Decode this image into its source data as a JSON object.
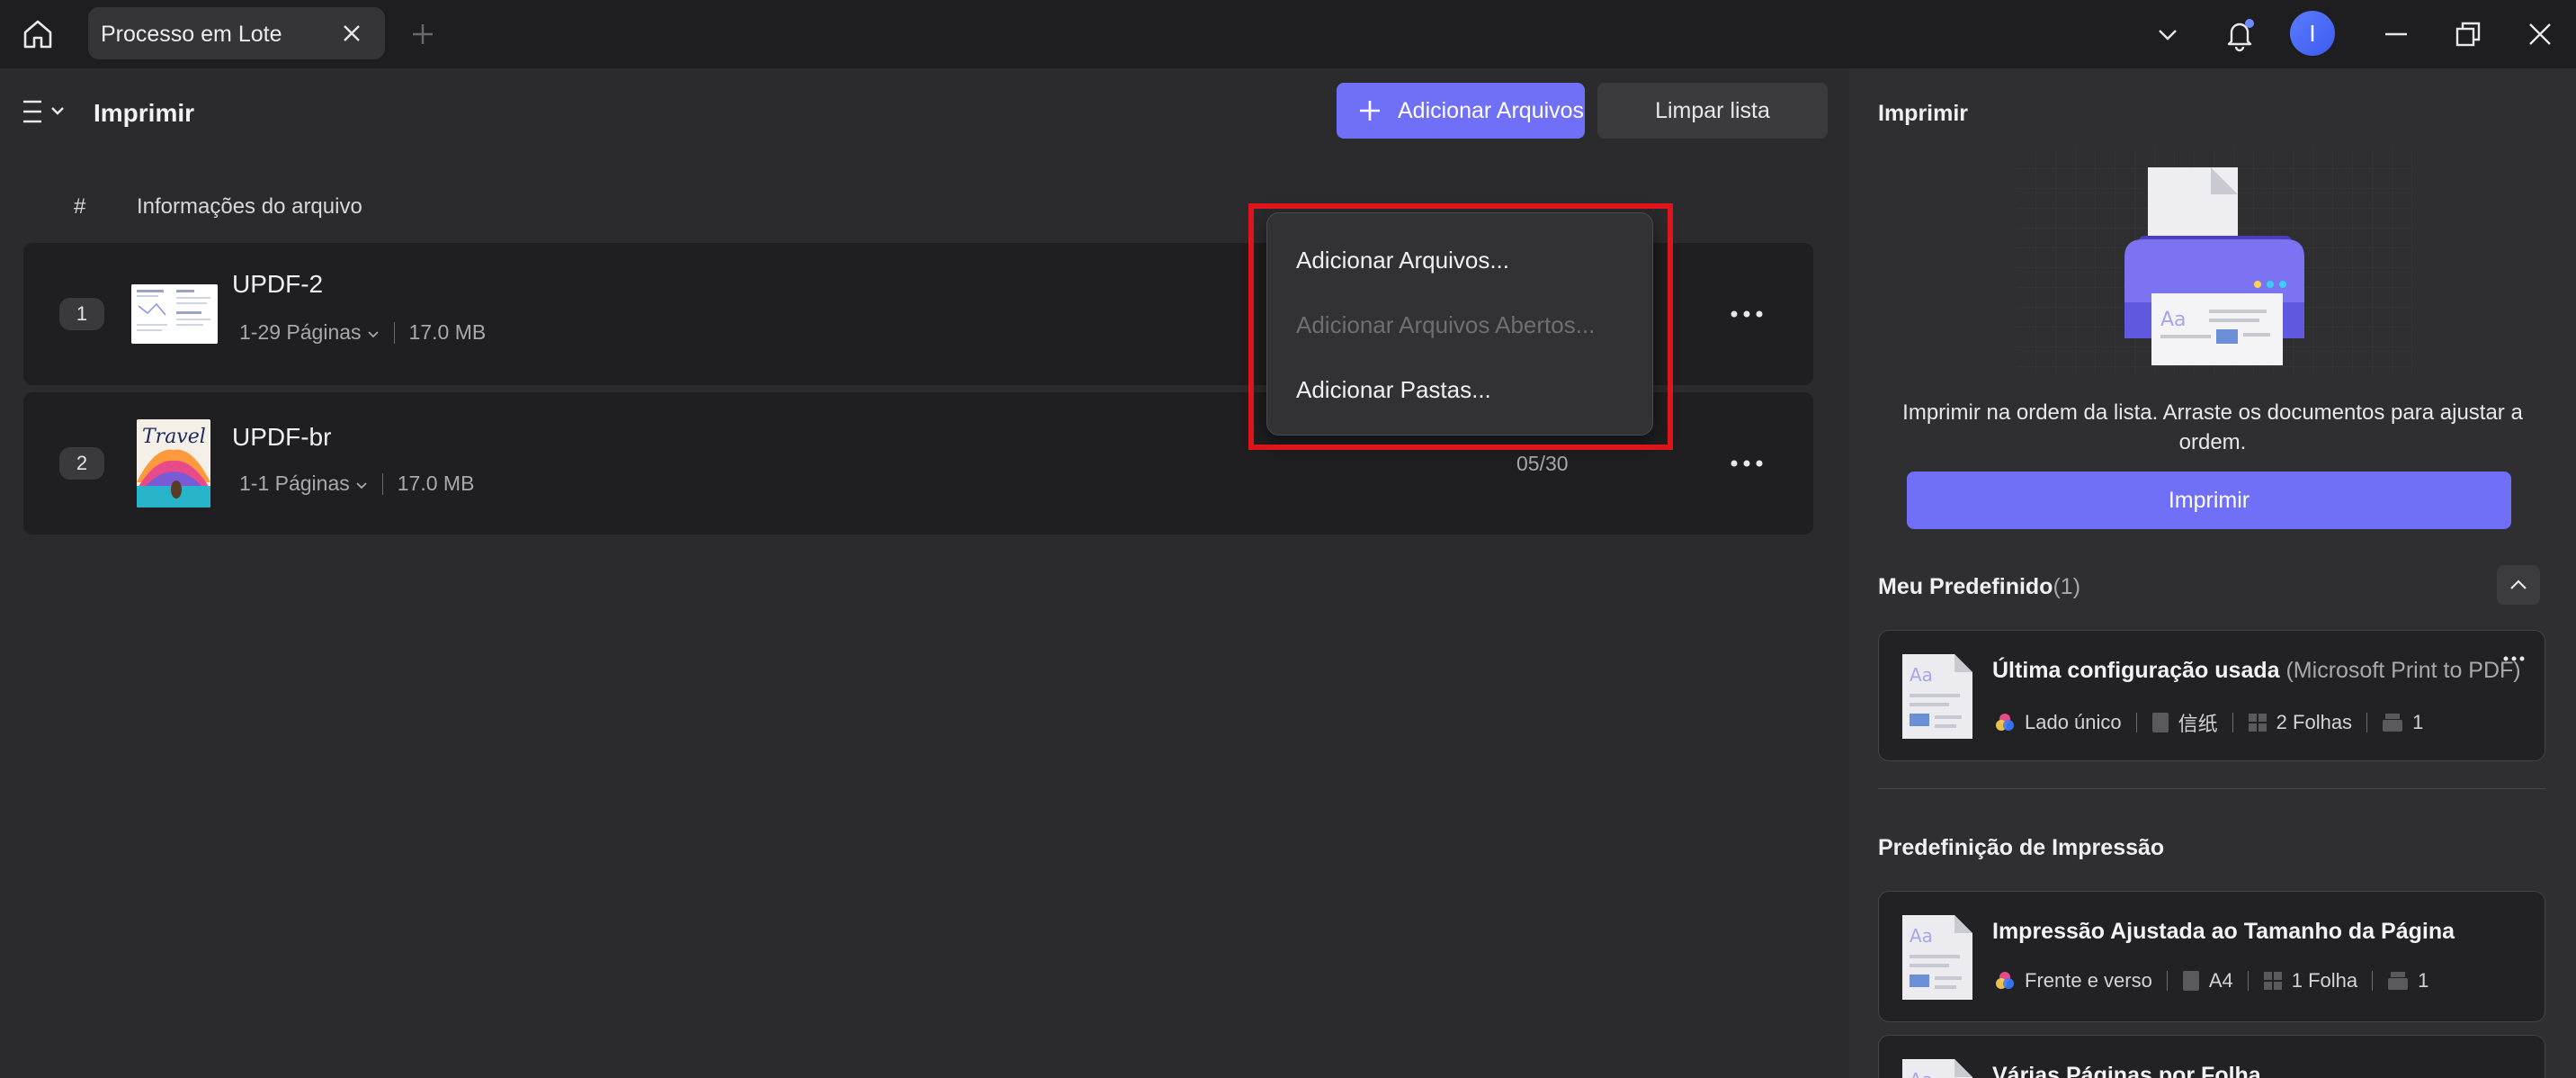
{
  "titlebar": {
    "tab_label": "Processo em Lote",
    "avatar_initial": "I"
  },
  "toolbar": {
    "page_title": "Imprimir",
    "add_files_label": "Adicionar Arquivos",
    "clear_list_label": "Limpar lista"
  },
  "list": {
    "col_hash": "#",
    "col_info": "Informações do arquivo",
    "rows": [
      {
        "num": "1",
        "name": "UPDF-2",
        "pages": "1-29 Páginas",
        "size": "17.0 MB",
        "progress": ""
      },
      {
        "num": "2",
        "name": "UPDF-br",
        "pages": "1-1 Páginas",
        "size": "17.0 MB",
        "progress": "05/30"
      }
    ]
  },
  "dropdown": {
    "items": [
      {
        "label": "Adicionar Arquivos...",
        "enabled": true
      },
      {
        "label": "Adicionar Arquivos Abertos...",
        "enabled": false
      },
      {
        "label": "Adicionar Pastas...",
        "enabled": true
      }
    ]
  },
  "right": {
    "title": "Imprimir",
    "description": "Imprimir na ordem da lista. Arraste os documentos para ajustar a ordem.",
    "print_button": "Imprimir",
    "my_preset_title": "Meu Predefinido",
    "my_preset_count": "(1)",
    "my_preset": {
      "title": "Última configuração usada",
      "printer": "(Microsoft Print to PDF)",
      "sides": "Lado único",
      "paper": "信纸",
      "sheets": "2 Folhas",
      "copies": "1"
    },
    "print_preset_title": "Predefinição de Impressão",
    "presets": [
      {
        "title": "Impressão Ajustada ao Tamanho da Página",
        "sides": "Frente e verso",
        "paper": "A4",
        "sheets": "1 Folha",
        "copies": "1"
      },
      {
        "title": "Várias Páginas por Folha"
      }
    ]
  },
  "colors": {
    "accent": "#6f6ff7",
    "highlight": "#e0141b",
    "panel": "#2f2f31",
    "row": "#1f1f21"
  }
}
